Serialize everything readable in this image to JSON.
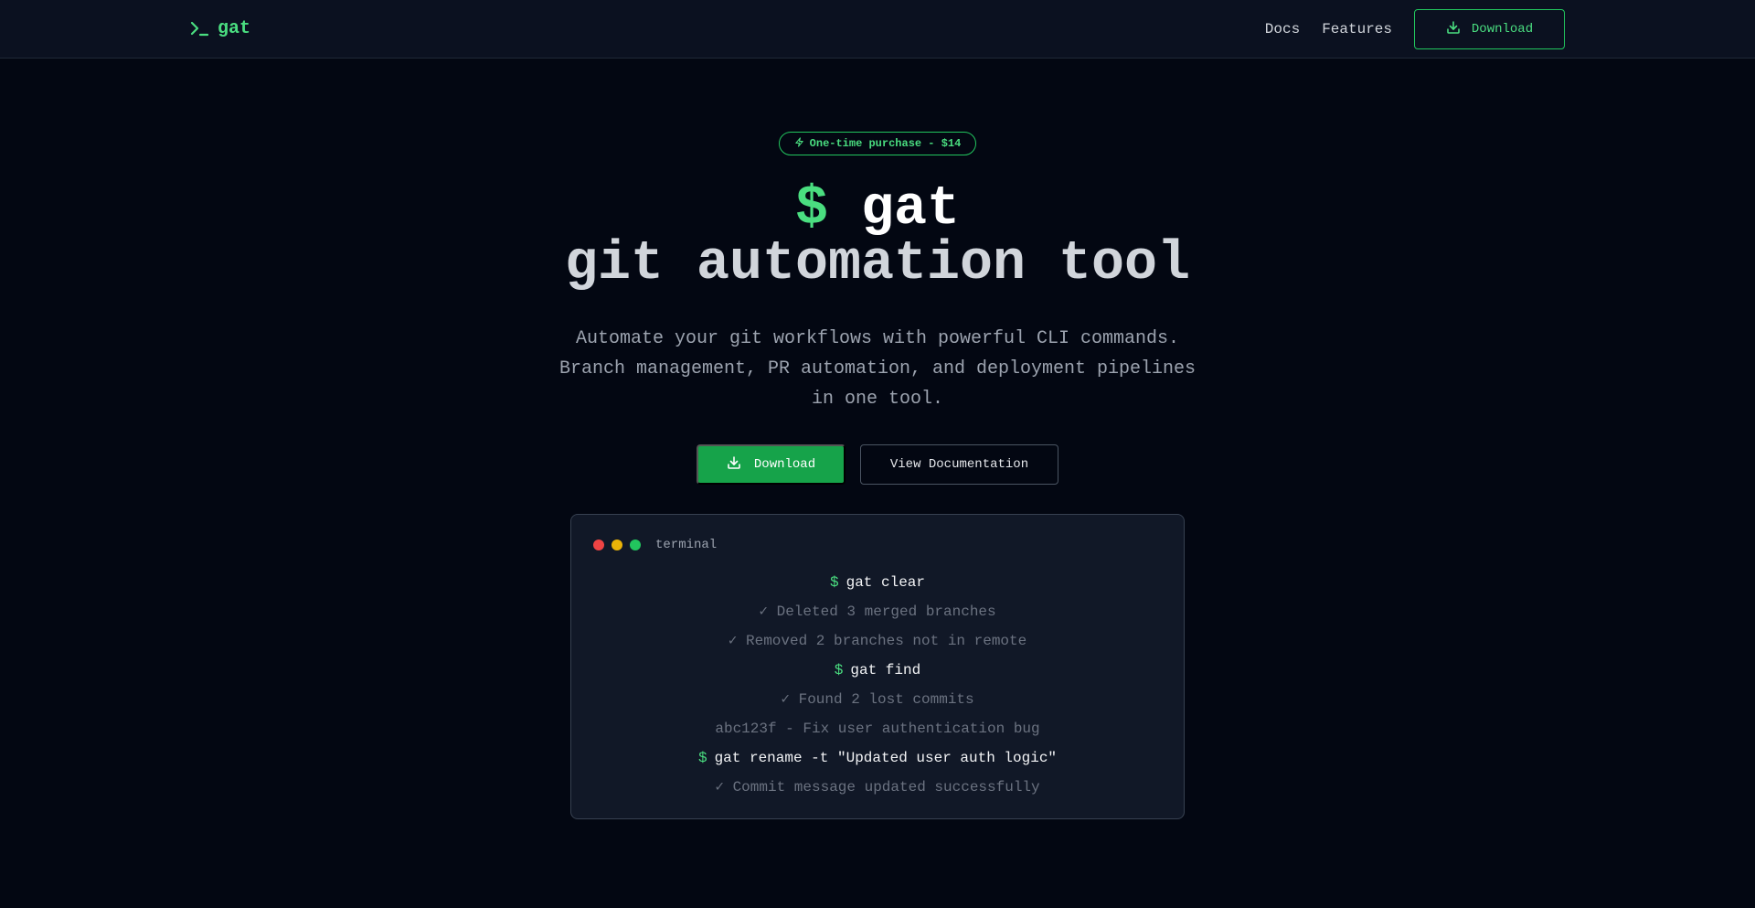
{
  "nav": {
    "brand": "gat",
    "links": [
      "Docs",
      "Features"
    ],
    "download_label": "Download"
  },
  "hero": {
    "badge": "One-time purchase - $14",
    "title_prompt": "$",
    "title_name": "gat",
    "title_line2": "git automation tool",
    "subtitle": "Automate your git workflows with powerful CLI commands. Branch management, PR automation, and deployment pipelines in one tool.",
    "download_label": "Download",
    "docs_label": "View Documentation"
  },
  "terminal": {
    "label": "terminal",
    "prompt": "$",
    "lines": [
      {
        "kind": "cmd",
        "text": "gat clear"
      },
      {
        "kind": "out",
        "text": "✓ Deleted 3 merged branches"
      },
      {
        "kind": "out",
        "text": "✓ Removed 2 branches not in remote"
      },
      {
        "kind": "cmd",
        "text": "gat find"
      },
      {
        "kind": "out",
        "text": "✓ Found 2 lost commits"
      },
      {
        "kind": "plain",
        "text": "abc123f - Fix user authentication bug"
      },
      {
        "kind": "cmd",
        "text": "gat rename -t \"Updated user auth logic\""
      },
      {
        "kind": "out",
        "text": "✓ Commit message updated successfully"
      }
    ]
  },
  "colors": {
    "accent": "#4ade80",
    "accent_dark": "#16a34a",
    "background": "#030712",
    "nav_bg": "#0b1120",
    "terminal_bg": "#111827"
  },
  "icons": {
    "brand": "terminal-prompt-icon",
    "download": "download-icon",
    "badge": "zap-icon"
  }
}
